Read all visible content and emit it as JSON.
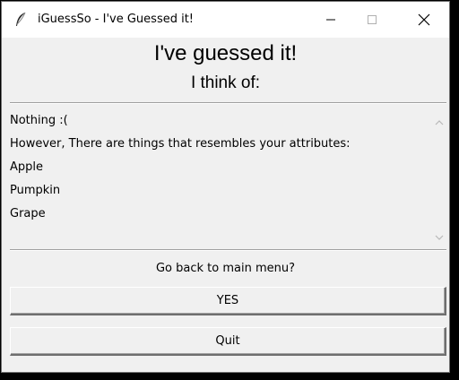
{
  "window": {
    "title": "iGuessSo - I've Guessed it!",
    "icon": "feather-icon"
  },
  "header": {
    "title": "I've guessed it!",
    "subtitle": "I think of:"
  },
  "results": {
    "lines": [
      "Nothing :(",
      "However, There are things that resembles your attributes:",
      "Apple",
      "Pumpkin",
      "Grape"
    ]
  },
  "prompt": {
    "question": "Go back to main menu?",
    "yes_label": "YES",
    "quit_label": "Quit"
  }
}
